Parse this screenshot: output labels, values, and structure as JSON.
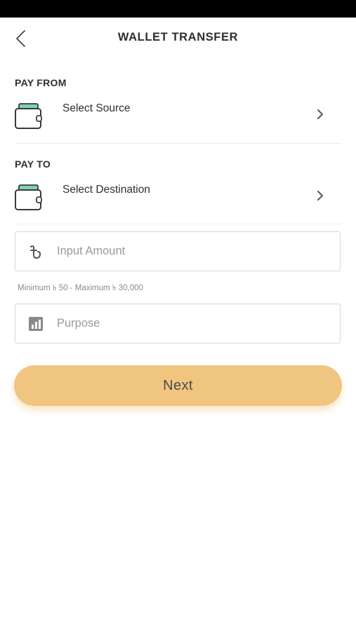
{
  "header": {
    "title": "WALLET TRANSFER",
    "back_icon": "chevron-left-icon"
  },
  "pay_from": {
    "label": "PAY FROM",
    "placeholder": "Select Source",
    "icon": "wallet-icon"
  },
  "pay_to": {
    "label": "PAY TO",
    "placeholder": "Select Destination",
    "icon": "wallet-icon"
  },
  "amount": {
    "placeholder": "Input Amount",
    "value": "",
    "icon": "taka-currency-icon",
    "hint": "Minimum ৳ 50 - Maximum ৳ 30,000"
  },
  "purpose": {
    "placeholder": "Purpose",
    "value": "",
    "icon": "purpose-chart-icon"
  },
  "next_button": {
    "label": "Next",
    "color": "#f0c580"
  },
  "colors": {
    "wallet_accent": "#7ed3b4",
    "status_bar": "#000000"
  }
}
